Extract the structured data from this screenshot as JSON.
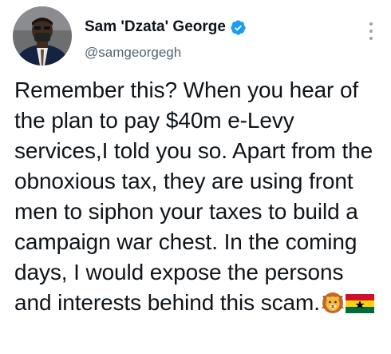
{
  "author": {
    "display_name": "Sam 'Dzata' George",
    "handle": "@samgeorgegh",
    "verified": true,
    "verified_color": "#1d9bf0"
  },
  "tweet": {
    "text": "Remember this? When you hear of the plan to pay $40m e-Levy services,I told you so. Apart from the obnoxious tax, they are using front men to siphon your taxes to build a campaign war chest. In the coming days, I would expose the persons and interests behind this scam.",
    "emojis": [
      "lion-emoji",
      "ghana-flag-emoji"
    ]
  },
  "icons": {
    "more": "more-options-icon",
    "verified": "verified-badge-icon"
  }
}
